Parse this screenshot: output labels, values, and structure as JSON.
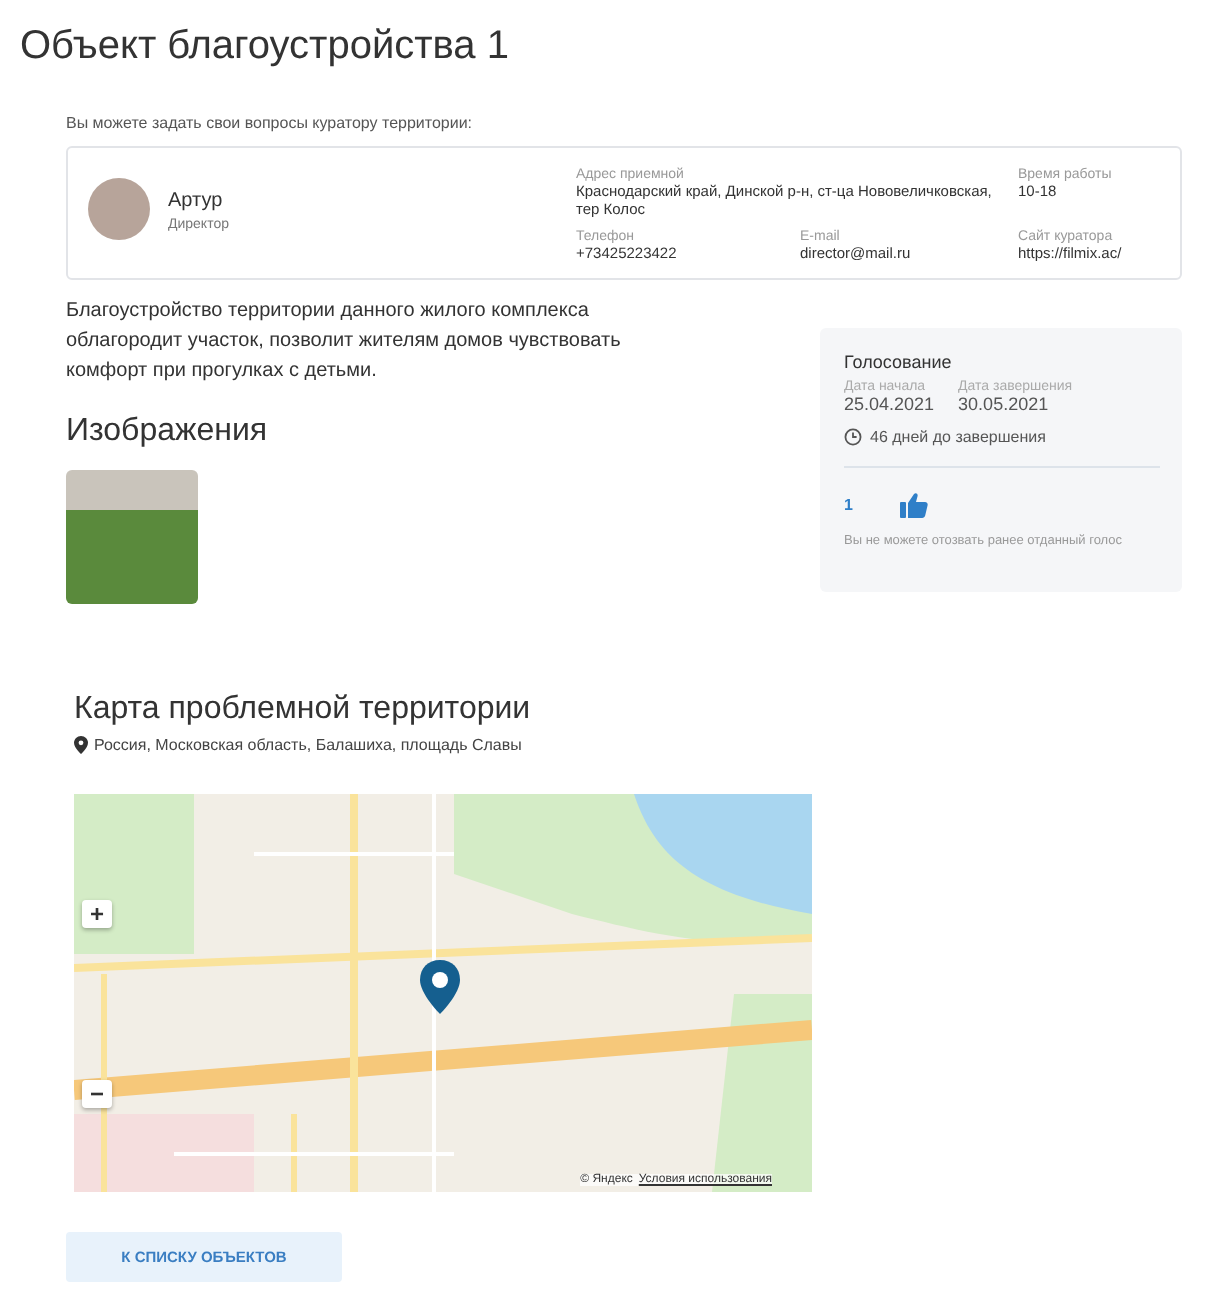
{
  "page": {
    "title": "Объект благоустройства 1"
  },
  "curator": {
    "intro": "Вы можете задать свои вопросы куратору территории:",
    "name": "Артур",
    "role": "Директор",
    "fields": [
      {
        "label": "Адрес приемной",
        "value": "Краснодарский край, Динской р-н, ст-ца Нововеличковская, тер Колос"
      },
      {
        "label": "Время работы",
        "value": "10-18"
      },
      {
        "label": "Телефон",
        "value": "+73425223422"
      },
      {
        "label": "E-mail",
        "value": "director@mail.ru"
      },
      {
        "label": "Сайт куратора",
        "value": "https://filmix.ac/"
      }
    ]
  },
  "description": "Благоустройство территории данного жилого комплекса облагородит участок, позволит жителям домов чувствовать комфорт при прогулках с детьми.",
  "images": {
    "heading": "Изображения"
  },
  "voting": {
    "title": "Голосование",
    "dates": [
      {
        "label": "Дата начала",
        "value": "25.04.2021"
      },
      {
        "label": "Дата завершения",
        "value": "30.05.2021"
      }
    ],
    "remaining": "46 дней до завершения",
    "likes": "1",
    "liked": true,
    "note": "Вы не можете отозвать ранее отданный голос"
  },
  "map": {
    "heading": "Карта проблемной территории",
    "address": "Россия, Московская область, Балашиха, площадь Славы",
    "zoom_in": "+",
    "zoom_out": "−",
    "attribution": "© Яндекс",
    "terms": "Условия использования"
  },
  "back_button": "К СПИСКУ ОБЪЕКТОВ"
}
